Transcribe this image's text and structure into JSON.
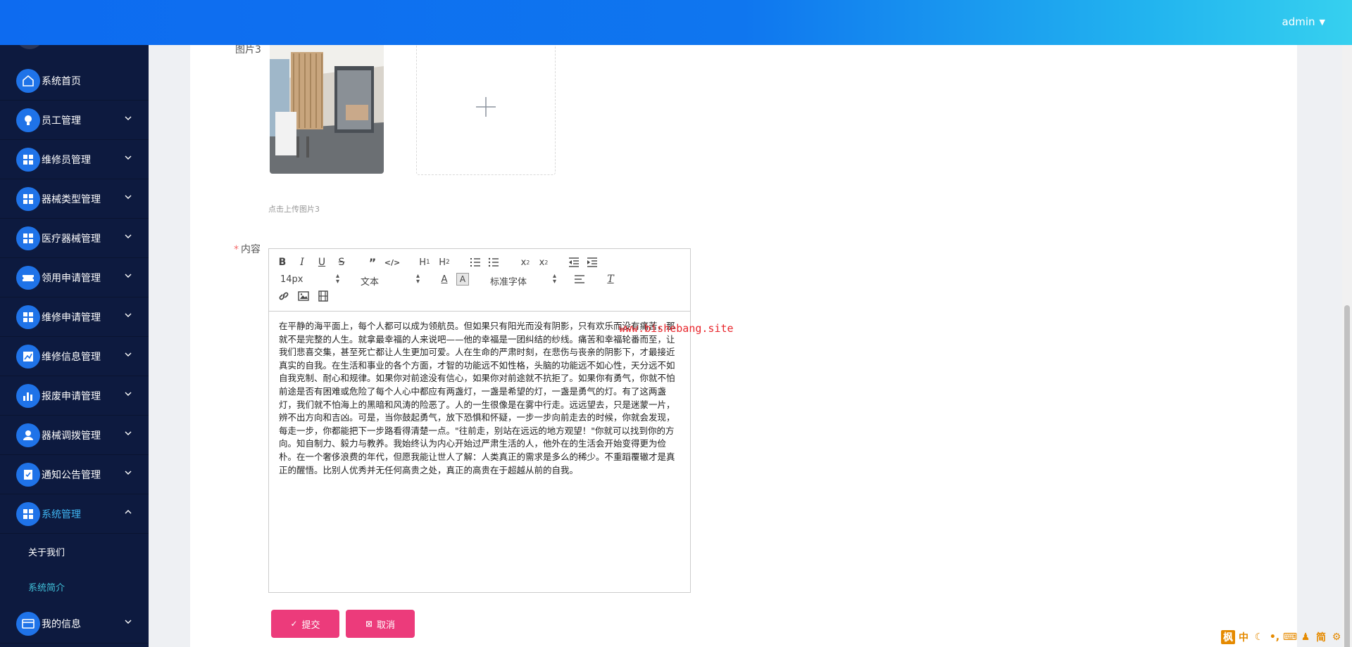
{
  "header": {
    "user": "admin"
  },
  "sidebar": {
    "items": [
      {
        "label": "系统首页",
        "icon": "home-icon",
        "has_arrow": false
      },
      {
        "label": "员工管理",
        "icon": "bulb-icon",
        "has_arrow": true
      },
      {
        "label": "维修员管理",
        "icon": "grid-icon",
        "has_arrow": true
      },
      {
        "label": "器械类型管理",
        "icon": "grid-icon",
        "has_arrow": true
      },
      {
        "label": "医疗器械管理",
        "icon": "grid-icon",
        "has_arrow": true
      },
      {
        "label": "领用申请管理",
        "icon": "ticket-icon",
        "has_arrow": true
      },
      {
        "label": "维修申请管理",
        "icon": "grid-icon",
        "has_arrow": true
      },
      {
        "label": "维修信息管理",
        "icon": "chart-icon",
        "has_arrow": true
      },
      {
        "label": "报废申请管理",
        "icon": "bar-chart-icon",
        "has_arrow": true
      },
      {
        "label": "器械调拨管理",
        "icon": "user-icon",
        "has_arrow": true
      },
      {
        "label": "通知公告管理",
        "icon": "notice-icon",
        "has_arrow": true
      },
      {
        "label": "系统管理",
        "icon": "grid-icon",
        "has_arrow": true,
        "expanded": true
      },
      {
        "label": "我的信息",
        "icon": "card-icon",
        "has_arrow": true
      }
    ],
    "sub_items": [
      {
        "label": "关于我们",
        "active": false
      },
      {
        "label": "系统简介",
        "active": true
      }
    ]
  },
  "form": {
    "image3_label": "图片3",
    "upload_hint": "点击上传图片3",
    "content_label": "内容",
    "editor": {
      "font_size": "14px",
      "text_style": "文本",
      "font_family": "标准字体",
      "body": "在平静的海平面上，每个人都可以成为领航员。但如果只有阳光而没有阴影，只有欢乐而没有痛苦，那就不是完整的人生。就拿最幸福的人来说吧——他的幸福是一团纠结的纱线。痛苦和幸福轮番而至，让我们悲喜交集，甚至死亡都让人生更加可爱。人在生命的严肃时刻，在悲伤与丧亲的阴影下，才最接近真实的自我。在生活和事业的各个方面，才智的功能远不如性格，头脑的功能远不如心性，天分远不如自我克制、耐心和规律。如果你对前途没有信心，如果你对前途就不抗拒了。如果你有勇气，你就不怕前途是否有困难或危险了每个人心中都应有两盏灯，一盏是希望的灯，一盏是勇气的灯。有了这两盏灯，我们就不怕海上的黑暗和风涛的险恶了。人的一生很像是在雾中行走。远远望去，只是迷蒙一片，辨不出方向和吉凶。可是，当你鼓起勇气，放下恐惧和怀疑，一步一步向前走去的时候，你就会发现，每走一步，你都能把下一步路看得清楚一点。\"往前走，别站在远远的地方观望！\"你就可以找到你的方向。知自制力、毅力与教养。我始终认为内心开始过严肃生活的人，他外在的生活会开始变得更为俭朴。在一个奢侈浪费的年代，但愿我能让世人了解：人类真正的需求是多么的稀少。不重蹈覆辙才是真正的醒悟。比别人优秀并无任何高贵之处，真正的高贵在于超越从前的自我。"
    },
    "submit_label": "提交",
    "cancel_label": "取消"
  },
  "watermark": "www.bishebang.site",
  "tray": [
    "中",
    "简"
  ],
  "colors": {
    "header_start": "#0d6bf0",
    "header_end": "#36d0ef",
    "sidebar_bg": "#0d1a3f",
    "icon_bg": "#1f73e8",
    "active_text": "#41c1d9",
    "button_bg": "#ec3b7b",
    "watermark": "#e8272d"
  }
}
